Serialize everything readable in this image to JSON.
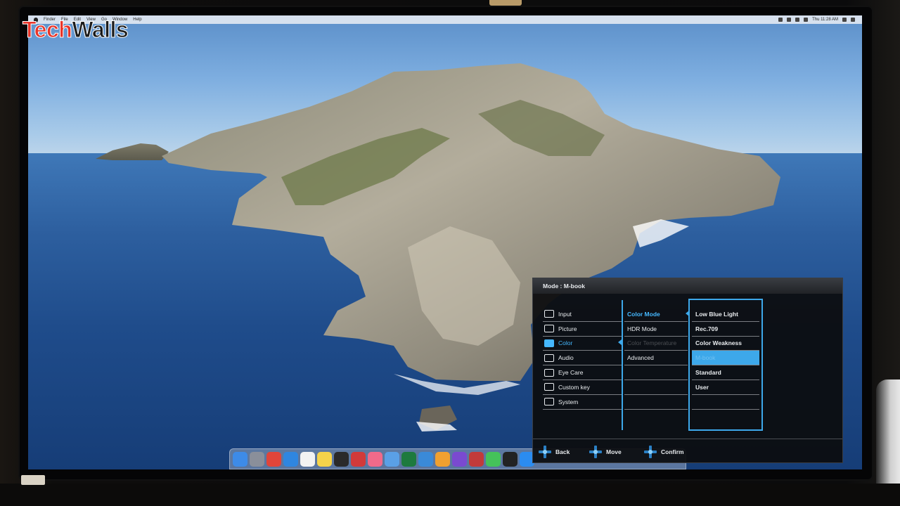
{
  "watermark": {
    "part1": "Tech",
    "part2": "Walls"
  },
  "menubar": {
    "items": [
      "Finder",
      "File",
      "Edit",
      "View",
      "Go",
      "Window",
      "Help"
    ],
    "clock": "Thu 11:28 AM"
  },
  "osd": {
    "title": "Mode : M-book",
    "categories": [
      {
        "label": "Input",
        "icon": "input-icon"
      },
      {
        "label": "Picture",
        "icon": "picture-icon"
      },
      {
        "label": "Color",
        "icon": "color-icon",
        "selected": true
      },
      {
        "label": "Audio",
        "icon": "audio-icon"
      },
      {
        "label": "Eye Care",
        "icon": "eye-care-icon"
      },
      {
        "label": "Custom key",
        "icon": "custom-key-icon"
      },
      {
        "label": "System",
        "icon": "system-icon"
      }
    ],
    "color_options": [
      {
        "label": "Color Mode",
        "selected": true
      },
      {
        "label": "HDR Mode"
      },
      {
        "label": "Color Temperature",
        "disabled": true
      },
      {
        "label": "Advanced"
      },
      {
        "label": ""
      },
      {
        "label": ""
      },
      {
        "label": ""
      }
    ],
    "modes": [
      {
        "label": "Low Blue Light"
      },
      {
        "label": "Rec.709"
      },
      {
        "label": "Color Weakness"
      },
      {
        "label": "M-book",
        "highlighted": true
      },
      {
        "label": "Standard"
      },
      {
        "label": "User"
      },
      {
        "label": ""
      }
    ],
    "footer": {
      "back": "Back",
      "move": "Move",
      "confirm": "Confirm"
    },
    "accent": "#3da8ea"
  },
  "dock": {
    "apps": [
      "finder",
      "launchpad",
      "chrome",
      "safari",
      "calendar",
      "notes",
      "activity-monitor",
      "no-entry",
      "music",
      "preview",
      "excel",
      "quicktime",
      "photos",
      "final-cut",
      "photo-booth",
      "messages",
      "terminal",
      "app-store"
    ]
  }
}
